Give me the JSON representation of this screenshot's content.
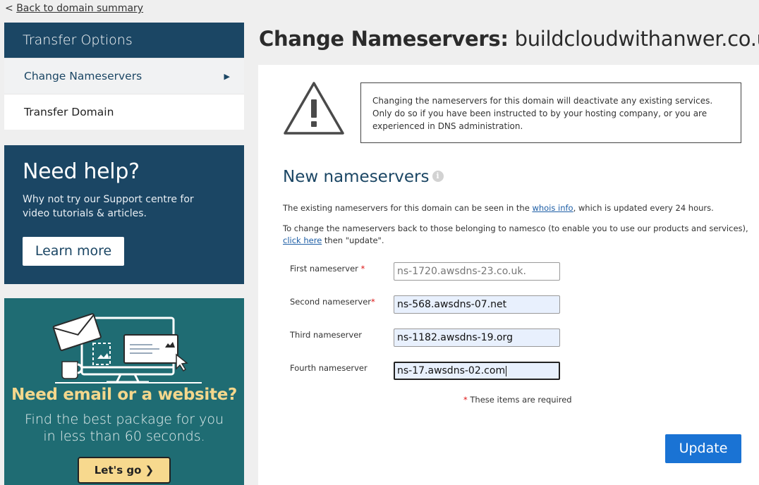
{
  "nav": {
    "back_prefix": "<",
    "back_label": "Back to domain summary"
  },
  "sidebar": {
    "heading": "Transfer Options",
    "items": [
      {
        "label": "Change Nameservers",
        "active": true
      },
      {
        "label": "Transfer Domain",
        "active": false
      }
    ]
  },
  "help": {
    "title": "Need help?",
    "text": "Why not try our Support centre for video tutorials & articles.",
    "button": "Learn more"
  },
  "promo": {
    "title": "Need email or a website?",
    "line1": "Find the best package for you",
    "line2": "in less than 60 seconds.",
    "button": "Let's go"
  },
  "page": {
    "title_prefix": "Change Nameservers:",
    "domain": "buildcloudwithanwer.co.uk",
    "info_glyph": "i"
  },
  "warning": {
    "text": "Changing the nameservers for this domain will deactivate any existing services. Only do so if you have been instructed to by your hosting company, or you are experienced in DNS administration."
  },
  "nameservers": {
    "heading": "New nameservers",
    "intro_before": "The existing nameservers for this domain can be seen in the ",
    "intro_link": "whois info",
    "intro_after": ", which is updated every 24 hours.",
    "reset_before": "To change the nameservers back to those belonging to namesco (to enable you to use our products and services), ",
    "reset_link": "click here",
    "reset_after": " then \"update\".",
    "fields": [
      {
        "label": "First nameserver",
        "required": "*",
        "value": "ns-1720.awsdns-23.co.uk."
      },
      {
        "label": "Second nameserver",
        "required": "*",
        "value": "ns-568.awsdns-07.net"
      },
      {
        "label": "Third nameserver",
        "required": "",
        "value": "ns-1182.awsdns-19.org"
      },
      {
        "label": "Fourth nameserver",
        "required": "",
        "value": "ns-17.awsdns-02.com"
      }
    ],
    "required_mark": "*",
    "required_note": "These items are required",
    "submit": "Update"
  },
  "colors": {
    "navy": "#1b4664",
    "teal": "#1f6c73",
    "accent_blue": "#1a73d4",
    "promo_yellow": "#f7d98e"
  }
}
